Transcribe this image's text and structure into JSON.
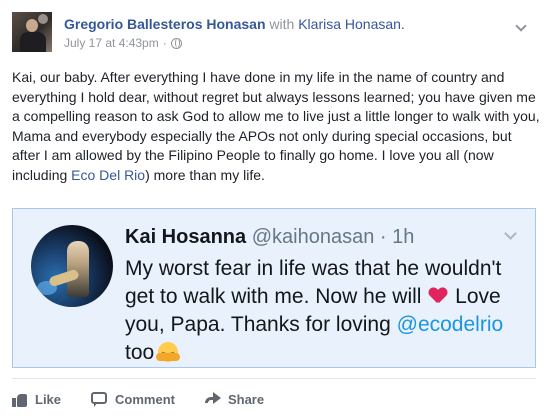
{
  "post": {
    "author": "Gregorio Ballesteros Honasan",
    "with_text": "with",
    "tagged": "Klarisa Honasan.",
    "timestamp": "July 17 at 4:43pm",
    "separator": "·",
    "privacy_icon": "globe-icon",
    "body_pre": "Kai, our baby. After everything I have done in my life in the name of country and everything I hold dear, without regret but always lessons learned; you have given me a compelling reason to ask God to allow me to live just a little longer to walk with you, Mama and everybody especially the APOs not only during special occasions, but after I am allowed by the Filipino People to finally go home. I love you all (now including ",
    "body_link": "Eco Del Rio",
    "body_post": ") more than my life."
  },
  "tweet": {
    "name": "Kai Hosanna",
    "handle": "@kaihonasan",
    "separator": "·",
    "time": "1h",
    "text_part1": "My worst fear in life was that he wouldn't get to walk with me. Now he will",
    "text_part2": "Love you, Papa. Thanks for loving",
    "mention": "@ecodelrio",
    "text_part3": "too",
    "colors": {
      "background": "#e9f2fc",
      "border": "#a8c7ef",
      "link": "#1b95e0"
    }
  },
  "actions": {
    "like": "Like",
    "comment": "Comment",
    "share": "Share"
  },
  "colors": {
    "name_link": "#365899",
    "meta": "#90949c",
    "text": "#1d2129",
    "heart": "#e0245e"
  }
}
